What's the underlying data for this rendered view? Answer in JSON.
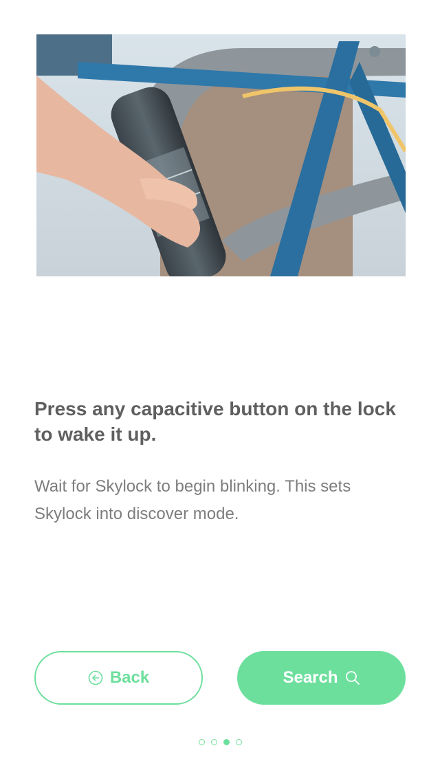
{
  "content": {
    "title": "Press any capacitive button on the lock to wake it up.",
    "body": "Wait for Skylock to begin blinking. This sets Skylock into discover mode."
  },
  "buttons": {
    "back_label": "Back",
    "back_icon": "arrow-left-circle-icon",
    "search_label": "Search",
    "search_icon": "search-icon"
  },
  "pager": {
    "total": 4,
    "active_index": 3
  },
  "colors": {
    "accent": "#6ddf9d",
    "title": "#5f5f5f",
    "body": "#7d7d7d"
  }
}
